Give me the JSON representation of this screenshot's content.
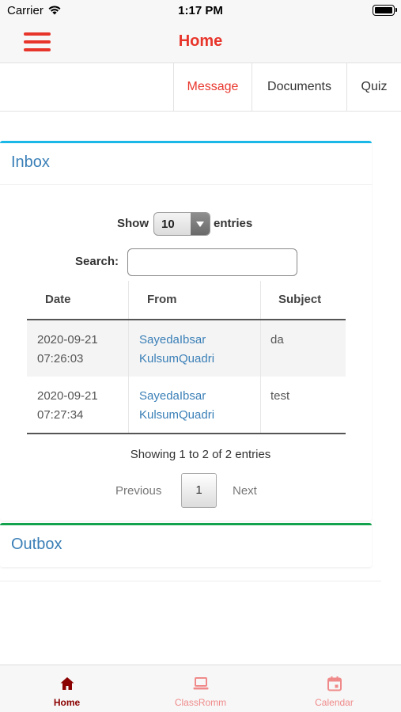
{
  "status_bar": {
    "carrier": "Carrier",
    "time": "1:17 PM"
  },
  "nav": {
    "title": "Home",
    "menu_icon": "hamburger-menu-icon"
  },
  "tabs": [
    {
      "label": "Message",
      "active": true
    },
    {
      "label": "Documents",
      "active": false
    },
    {
      "label": "Quiz",
      "active": false
    }
  ],
  "inbox": {
    "heading": "Inbox",
    "show_label": "Show",
    "entries_per_page": "10",
    "entries_label": "entries",
    "search_label": "Search:",
    "search_value": "",
    "columns": [
      "Date",
      "From",
      "Subject"
    ],
    "rows": [
      {
        "date": "2020-09-21",
        "time": "07:26:03",
        "from_first": "SayedaIbsar",
        "from_last": "KulsumQuadri",
        "subject": "da"
      },
      {
        "date": "2020-09-21",
        "time": "07:27:34",
        "from_first": "SayedaIbsar",
        "from_last": "KulsumQuadri",
        "subject": "test"
      }
    ],
    "info": "Showing 1 to 2 of 2 entries",
    "pagination": {
      "previous": "Previous",
      "current_page": "1",
      "next": "Next"
    }
  },
  "outbox": {
    "heading": "Outbox"
  },
  "tabbar": [
    {
      "label": "Home",
      "icon": "home-icon",
      "active": true
    },
    {
      "label": "ClassRomm",
      "icon": "laptop-icon",
      "active": false
    },
    {
      "label": "Calendar",
      "icon": "calendar-icon",
      "active": false
    }
  ],
  "colors": {
    "accent": "#e8352b",
    "inbox_border": "#1bb7e6",
    "outbox_border": "#12a24d",
    "link": "#3a7fb7",
    "tabbar_active": "#8b0000",
    "tabbar_inactive": "#f08a8a"
  }
}
